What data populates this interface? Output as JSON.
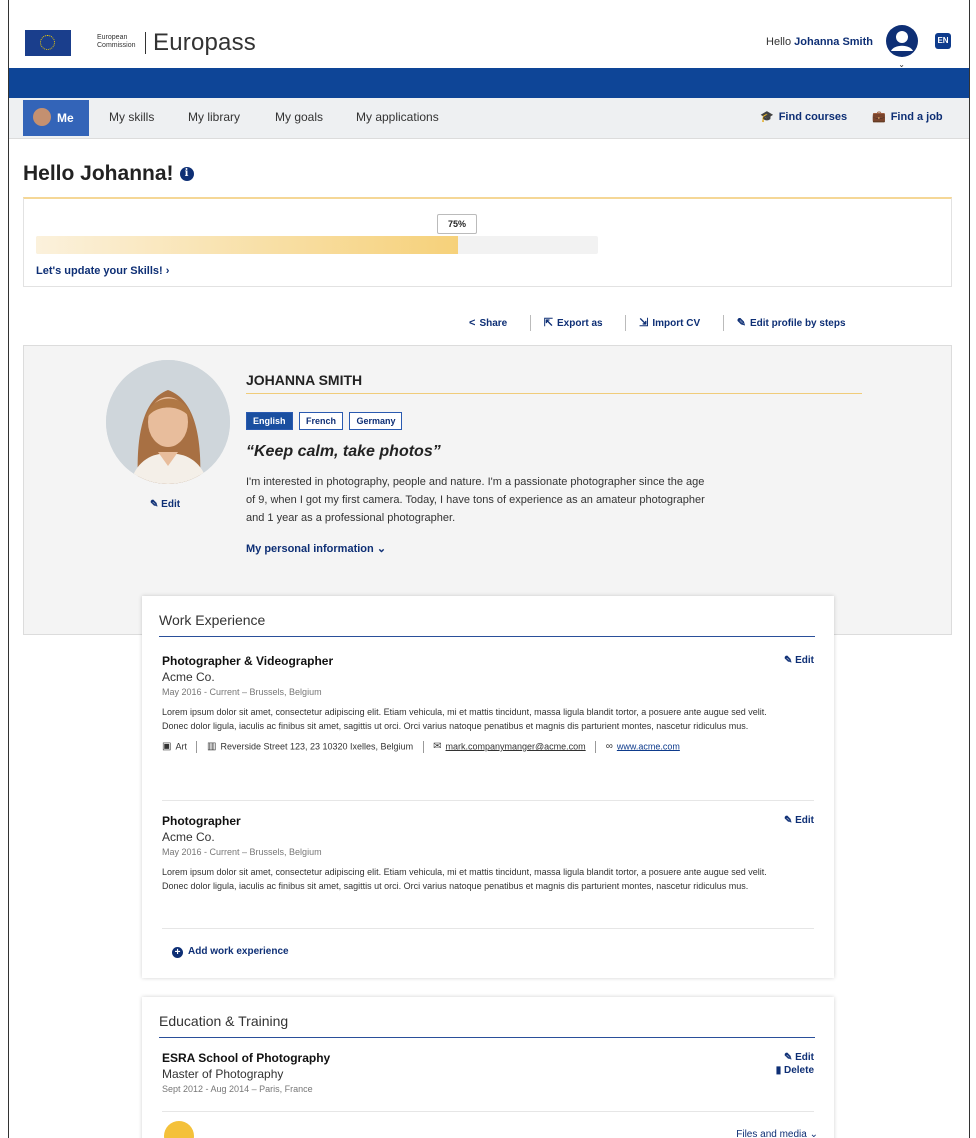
{
  "header": {
    "ec_line1": "European",
    "ec_line2": "Commission",
    "brand": "Europass",
    "hello_prefix": "Hello",
    "user_name": "Johanna Smith",
    "language": "EN"
  },
  "nav": {
    "me": "Me",
    "items": [
      "My skills",
      "My library",
      "My goals",
      "My applications"
    ],
    "find_courses": "Find courses",
    "find_job": "Find a job"
  },
  "greeting": "Hello Johanna!",
  "progress": {
    "percent_label": "75%",
    "value": 0.75,
    "link": "Let's update your Skills!"
  },
  "actions": {
    "share": "Share",
    "export": "Export as",
    "import": "Import CV",
    "edit_steps": "Edit profile by steps"
  },
  "profile": {
    "name": "JOHANNA SMITH",
    "languages": [
      "English",
      "French",
      "Germany"
    ],
    "quote": "“Keep calm, take photos”",
    "bio": "I'm interested in photography, people and nature. I'm a passionate photographer since the age of 9, when I got my first camera. Today, I have tons of experience as an amateur photographer and 1 year as a professional photographer.",
    "edit": "Edit",
    "personal_info": "My personal information"
  },
  "work": {
    "title": "Work Experience",
    "entries": [
      {
        "title": "Photographer & Videographer",
        "company": "Acme Co.",
        "date": "May 2016 - Current – Brussels, Belgium",
        "desc": "Lorem ipsum dolor sit amet, consectetur adipiscing elit. Etiam vehicula, mi et mattis tincidunt, massa ligula blandit tortor, a posuere ante augue sed velit. Donec dolor ligula, iaculis ac finibus sit amet, sagittis ut orci. Orci varius natoque penatibus et magnis dis parturient montes, nascetur ridiculus mus.",
        "sector": "Art",
        "address": "Reverside Street 123, 23 10320 Ixelles, Belgium",
        "email": "mark.companymanger@acme.com",
        "website": "www.acme.com",
        "edit": "Edit"
      },
      {
        "title": "Photographer",
        "company": "Acme Co.",
        "date": "May 2016 - Current – Brussels, Belgium",
        "desc": "Lorem ipsum dolor sit amet, consectetur adipiscing elit. Etiam vehicula, mi et mattis tincidunt, massa ligula blandit tortor, a posuere ante augue sed velit. Donec dolor ligula, iaculis ac finibus sit amet, sagittis ut orci. Orci varius natoque penatibus et magnis dis parturient montes, nascetur ridiculus mus.",
        "edit": "Edit"
      }
    ],
    "add": "Add work experience"
  },
  "education": {
    "title": "Education & Training",
    "entry": {
      "title": "ESRA School of Photography",
      "degree": "Master of Photography",
      "date": "Sept 2012 - Aug 2014 – Paris, France",
      "edit": "Edit",
      "delete": "Delete"
    },
    "files": "Files and media"
  },
  "colors": {
    "brand_blue": "#0e4597",
    "link_navy": "#0e2f75",
    "progress_yellow": "#f6d17a"
  }
}
